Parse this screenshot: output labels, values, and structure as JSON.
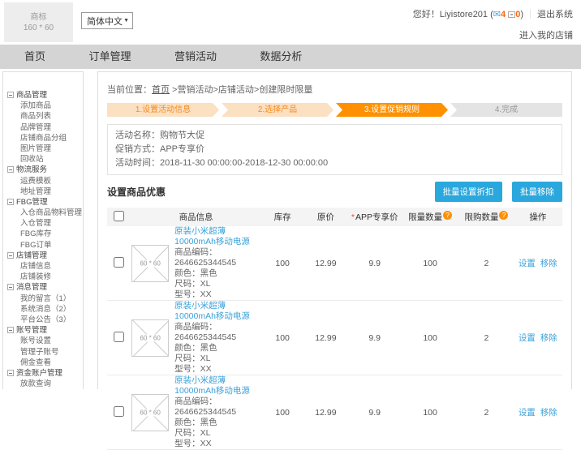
{
  "header": {
    "logo_line1": "商标",
    "logo_line2": "160 * 60",
    "language": "简体中文",
    "greeting": "您好！",
    "username": "Liyistore201",
    "paren_open": "(",
    "mail_count": "4",
    "notice_count": "0",
    "paren_close": ")",
    "sep": "｜",
    "logout": "退出系统",
    "enter_shop": "进入我的店铺"
  },
  "icons": {
    "mail": "✉",
    "arrow_down": "▼",
    "help": "?"
  },
  "nav": {
    "items": [
      {
        "label": "首页"
      },
      {
        "label": "订单管理"
      },
      {
        "label": "营销活动"
      },
      {
        "label": "数据分析"
      }
    ]
  },
  "sidebar": {
    "sections": [
      {
        "title": "商品管理",
        "items": [
          "添加商品",
          "商品列表",
          "品牌管理",
          "店铺商品分组",
          "图片管理",
          "回收站"
        ]
      },
      {
        "title": "物流服务",
        "items": [
          "运费模板",
          "地址管理"
        ]
      },
      {
        "title": "FBG管理",
        "items": [
          "入仓商品物料管理",
          "入仓管理",
          "FBG库存",
          "FBG订单"
        ]
      },
      {
        "title": "店铺管理",
        "items": [
          "店铺信息",
          "店铺装修"
        ]
      },
      {
        "title": "消息管理",
        "items": [
          "我的留言（1）",
          "系统消息（2）",
          "平台公告（3）"
        ]
      },
      {
        "title": "账号管理",
        "items": [
          "账号设置",
          "管理子账号",
          "佣金查看"
        ]
      },
      {
        "title": "资金账户管理",
        "items": [
          "放款查询"
        ]
      }
    ]
  },
  "breadcrumb": {
    "prefix": "当前位置：",
    "home": "首页",
    "trail": " >营销活动>店铺活动>创建限时限量"
  },
  "steps": [
    {
      "label": "1.设置活动信息"
    },
    {
      "label": "2.选择产品"
    },
    {
      "label": "3.设置促销规则"
    },
    {
      "label": "4.完成"
    }
  ],
  "activity": {
    "name_label": "活动名称：",
    "name": "购物节大促",
    "method_label": "促销方式：",
    "method": "APP专享价",
    "time_label": "活动时间：",
    "time": "2018-11-30 00:00:00-2018-12-30 00:00:00"
  },
  "section": {
    "title": "设置商品优惠",
    "batch_discount": "批量设置折扣",
    "batch_remove": "批量移除"
  },
  "table": {
    "col_product": "商品信息",
    "col_stock": "库存",
    "col_price": "原价",
    "col_app_price_mark": "*",
    "col_app_price": "APP专享价",
    "col_limit_qty": "限量数量",
    "col_purchase_limit": "限购数量",
    "col_actions": "操作",
    "rows": [
      {
        "image_placeholder": "60 * 60",
        "title": "原装小米超薄10000mAh移动电源",
        "lines": [
          "商品编码：2646625344545",
          "颜色：黑色",
          "尺码：XL",
          "型号：XX"
        ],
        "stock": "100",
        "price": "12.99",
        "app_price": "9.9",
        "limit_qty": "100",
        "purchase_limit": "2",
        "action_set": "设置",
        "action_remove": "移除"
      },
      {
        "image_placeholder": "60 * 60",
        "title": "原装小米超薄10000mAh移动电源",
        "lines": [
          "商品编码：2646625344545",
          "颜色：黑色",
          "尺码：XL",
          "型号：XX"
        ],
        "stock": "100",
        "price": "12.99",
        "app_price": "9.9",
        "limit_qty": "100",
        "purchase_limit": "2",
        "action_set": "设置",
        "action_remove": "移除"
      },
      {
        "image_placeholder": "60 * 60",
        "title": "原装小米超薄10000mAh移动电源",
        "lines": [
          "商品编码：2646625344545",
          "颜色：黑色",
          "尺码：XL",
          "型号：XX"
        ],
        "stock": "100",
        "price": "12.99",
        "app_price": "9.9",
        "limit_qty": "100",
        "purchase_limit": "2",
        "action_set": "设置",
        "action_remove": "移除"
      }
    ]
  },
  "colors": {
    "accent_orange": "#ff9000",
    "step_done_bg": "#fbe0c2",
    "link_blue": "#3ba1d9",
    "button_blue": "#2aa7dd",
    "nav_bg": "#d4d4d4",
    "count_orange": "#f60"
  }
}
